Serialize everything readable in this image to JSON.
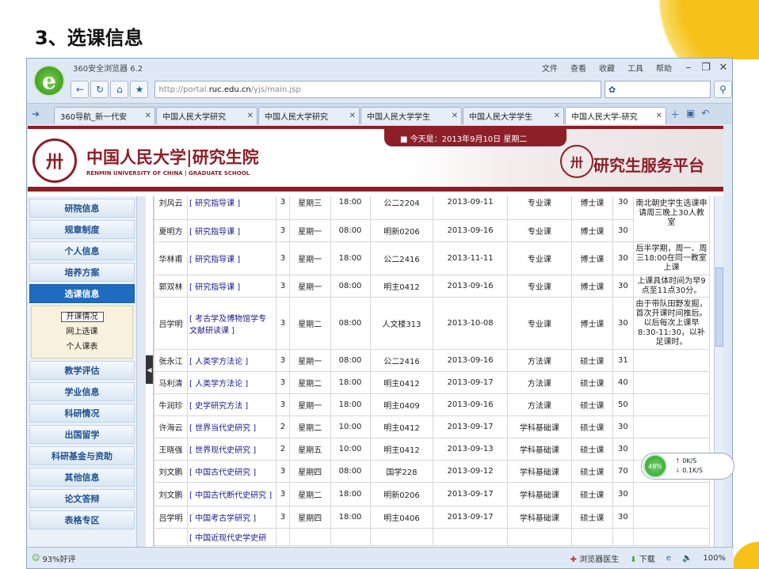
{
  "slide_title": "3、选课信息",
  "browser": {
    "title": "360安全浏览器 6.2",
    "menus": [
      "文件",
      "查看",
      "收藏",
      "工具",
      "帮助"
    ],
    "url_prefix": "http://portal.",
    "url_domain": "ruc.edu.cn",
    "url_suffix": "/yjs/main.jsp"
  },
  "tabs": [
    {
      "label": "360导航_新一代安"
    },
    {
      "label": "中国人民大学研究"
    },
    {
      "label": "中国人民大学研究"
    },
    {
      "label": "中国人民大学学生"
    },
    {
      "label": "中国人民大学学生"
    },
    {
      "label": "中国人民大学-研究"
    }
  ],
  "banner": {
    "date": "■ 今天是：2013年9月10日  星期二",
    "univ_cn": "中国人民大学|研究生院",
    "univ_en": "RENMIN UNIVERSITY OF CHINA | GRADUATE SCHOOL",
    "platform": "研究生服务平台"
  },
  "sidebar": {
    "items_top": [
      "研院信息",
      "规章制度",
      "个人信息",
      "培养方案",
      "选课信息"
    ],
    "subitems": [
      "开课情况",
      "网上选课",
      "个人课表"
    ],
    "items_bottom": [
      "教学评估",
      "学业信息",
      "科研情况",
      "出国留学",
      "科研基金与资助",
      "其他信息",
      "论文答辩",
      "表格专区"
    ]
  },
  "courses": [
    {
      "t": "刘风云",
      "c": "[ 研究指导课 ]",
      "cr": "3",
      "day": "星期三",
      "time": "18:00",
      "room": "公二2204",
      "date": "2013-09-11",
      "type": "专业课",
      "lv": "博士课",
      "n": "30"
    },
    {
      "t": "夏明方",
      "c": "[ 研究指导课 ]",
      "cr": "3",
      "day": "星期一",
      "time": "08:00",
      "room": "明新0206",
      "date": "2013-09-16",
      "type": "专业课",
      "lv": "博士课",
      "n": "30"
    },
    {
      "t": "华林甫",
      "c": "[ 研究指导课 ]",
      "cr": "3",
      "day": "星期一",
      "time": "18:00",
      "room": "公二2416",
      "date": "2013-11-11",
      "type": "专业课",
      "lv": "博士课",
      "n": "30"
    },
    {
      "t": "郭双林",
      "c": "[ 研究指导课 ]",
      "cr": "3",
      "day": "星期一",
      "time": "08:00",
      "room": "明主0412",
      "date": "2013-09-16",
      "type": "专业课",
      "lv": "博士课",
      "n": "30"
    },
    {
      "t": "吕学明",
      "c": "[ 考古学及博物馆学专文献研读课 ]",
      "cr": "3",
      "day": "星期二",
      "time": "08:00",
      "room": "人文楼313",
      "date": "2013-10-08",
      "type": "专业课",
      "lv": "博士课",
      "n": "30"
    },
    {
      "t": "张永江",
      "c": "[ 人类学方法论 ]",
      "cr": "3",
      "day": "星期一",
      "time": "08:00",
      "room": "公二2416",
      "date": "2013-09-16",
      "type": "方法课",
      "lv": "硕士课",
      "n": "31"
    },
    {
      "t": "马利清",
      "c": "[ 人类学方法论 ]",
      "cr": "3",
      "day": "星期二",
      "time": "18:00",
      "room": "明主0412",
      "date": "2013-09-17",
      "type": "方法课",
      "lv": "硕士课",
      "n": "40"
    },
    {
      "t": "牛润珍",
      "c": "[ 史学研究方法 ]",
      "cr": "3",
      "day": "星期一",
      "time": "18:00",
      "room": "明主0409",
      "date": "2013-09-16",
      "type": "方法课",
      "lv": "硕士课",
      "n": "50"
    },
    {
      "t": "许海云",
      "c": "[ 世界当代史研究 ]",
      "cr": "2",
      "day": "星期二",
      "time": "10:00",
      "room": "明主0412",
      "date": "2013-09-17",
      "type": "学科基础课",
      "lv": "硕士课",
      "n": "30"
    },
    {
      "t": "王晓强",
      "c": "[ 世界现代史研究 ]",
      "cr": "2",
      "day": "星期五",
      "time": "10:00",
      "room": "明主0412",
      "date": "2013-09-13",
      "type": "学科基础课",
      "lv": "硕士课",
      "n": "30"
    },
    {
      "t": "刘文鹏",
      "c": "[ 中国古代史研究 ]",
      "cr": "3",
      "day": "星期四",
      "time": "08:00",
      "room": "国学228",
      "date": "2013-09-12",
      "type": "学科基础课",
      "lv": "硕士课",
      "n": "70"
    },
    {
      "t": "刘文鹏",
      "c": "[ 中国古代断代史研究 ]",
      "cr": "3",
      "day": "星期二",
      "time": "18:00",
      "room": "明新0206",
      "date": "2013-09-17",
      "type": "学科基础课",
      "lv": "硕士课",
      "n": "30"
    },
    {
      "t": "吕学明",
      "c": "[ 中国考古学研究 ]",
      "cr": "3",
      "day": "星期四",
      "time": "18:00",
      "room": "明主0406",
      "date": "2013-09-17",
      "type": "学科基础课",
      "lv": "硕士课",
      "n": "30"
    },
    {
      "t": "",
      "c": "[ 中国近现代史学史研",
      "cr": "",
      "day": "",
      "time": "",
      "room": "",
      "date": "",
      "type": "",
      "lv": "",
      "n": ""
    }
  ],
  "notes": {
    "n1": "南北朝史学生选课申请周三晚上30人教室",
    "n2": "后半学期，周一、周三18:00在同一教室上课",
    "n3": "上课具体时间为早9点至11点30分。",
    "n4": "由于带队田野发掘，首次开课时间推后。以后每次上课早8:30-11:30，以补足课时。"
  },
  "status": {
    "left": "93%好评",
    "doctor": "浏览器医生",
    "download": "下载",
    "zoom": "100%"
  },
  "speed": {
    "pct": "49%",
    "up": "0K/S",
    "down": "0.1K/S"
  }
}
